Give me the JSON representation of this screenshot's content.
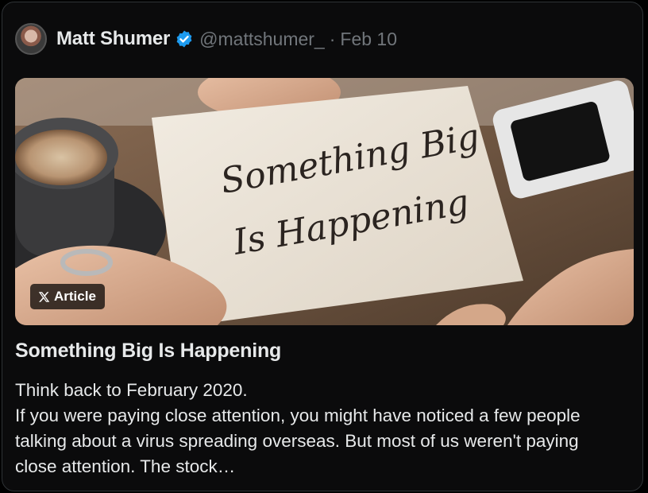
{
  "author": {
    "name": "Matt Shumer",
    "handle": "@mattshumer_",
    "separator": "·",
    "date": "Feb 10"
  },
  "media": {
    "badge_label": "Article",
    "badge_icon": "x-logo-icon",
    "note_text_line1": "Something Big",
    "note_text_line2": "Is Happening"
  },
  "article": {
    "title": "Something Big Is Happening",
    "body_line1": "Think back to February 2020.",
    "body_line2": "If you were paying close attention, you might have noticed a few people talking about a virus spreading overseas. But most of us weren't paying close attention. The stock…"
  },
  "colors": {
    "background": "#000000",
    "text_primary": "#e7e9ea",
    "text_secondary": "#71767b",
    "verified_blue": "#1d9bf0"
  }
}
